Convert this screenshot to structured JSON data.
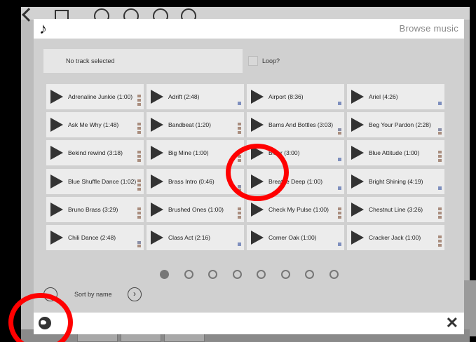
{
  "dialog": {
    "title": "Browse music",
    "status_text": "No track selected",
    "loop_label": "Loop?",
    "sort_label": "Sort by name"
  },
  "tracks": [
    {
      "label": "Adrenaline Junkie (1:00)",
      "tag": "stack"
    },
    {
      "label": "Adrift (2:48)",
      "tag": "blue"
    },
    {
      "label": "Airport (8:36)",
      "tag": "blue"
    },
    {
      "label": "Ariel (4:26)",
      "tag": "blue"
    },
    {
      "label": "Ask Me Why (1:48)",
      "tag": "stack"
    },
    {
      "label": "Bandbeat (1:20)",
      "tag": "stack"
    },
    {
      "label": "Barns And Bottles (3:03)",
      "tag": "mixed"
    },
    {
      "label": "Beg Your Pardon (2:28)",
      "tag": "mixed"
    },
    {
      "label": "Bekind rewind (3:18)",
      "tag": "stack"
    },
    {
      "label": "Big Mine (1:00)",
      "tag": "stack"
    },
    {
      "label": "Bitter (3:00)",
      "tag": "blue"
    },
    {
      "label": "Blue Attitude (1:00)",
      "tag": "stack"
    },
    {
      "label": "Blue Shuffle Dance (1:02)",
      "tag": "stack"
    },
    {
      "label": "Brass Intro (0:46)",
      "tag": "mixed"
    },
    {
      "label": "Breathe Deep (1:00)",
      "tag": "blue"
    },
    {
      "label": "Bright Shining (4:19)",
      "tag": "blue"
    },
    {
      "label": "Bruno Brass (3:29)",
      "tag": "stack"
    },
    {
      "label": "Brushed Ones (1:00)",
      "tag": "stack"
    },
    {
      "label": "Check My Pulse (1:00)",
      "tag": "stack"
    },
    {
      "label": "Chestnut Line (3:26)",
      "tag": "stack"
    },
    {
      "label": "Chili Dance (2:48)",
      "tag": "mixed"
    },
    {
      "label": "Class Act (2:16)",
      "tag": "blue"
    },
    {
      "label": "Corner Oak (1:00)",
      "tag": "blue"
    },
    {
      "label": "Cracker Jack (1:00)",
      "tag": "stack"
    }
  ],
  "pagination": {
    "pages": 8,
    "current": 1
  },
  "icons": {
    "header": "music-note-icon",
    "footer_left": "globe-icon",
    "footer_right": "close-icon",
    "tile": "play-icon"
  },
  "colors": {
    "annotation": "#ff0000",
    "dialog_bg": "#d0d0d0",
    "tile_bg": "#ececec"
  },
  "glyphs": {
    "note": "♪",
    "close": "✕",
    "next": "›"
  }
}
